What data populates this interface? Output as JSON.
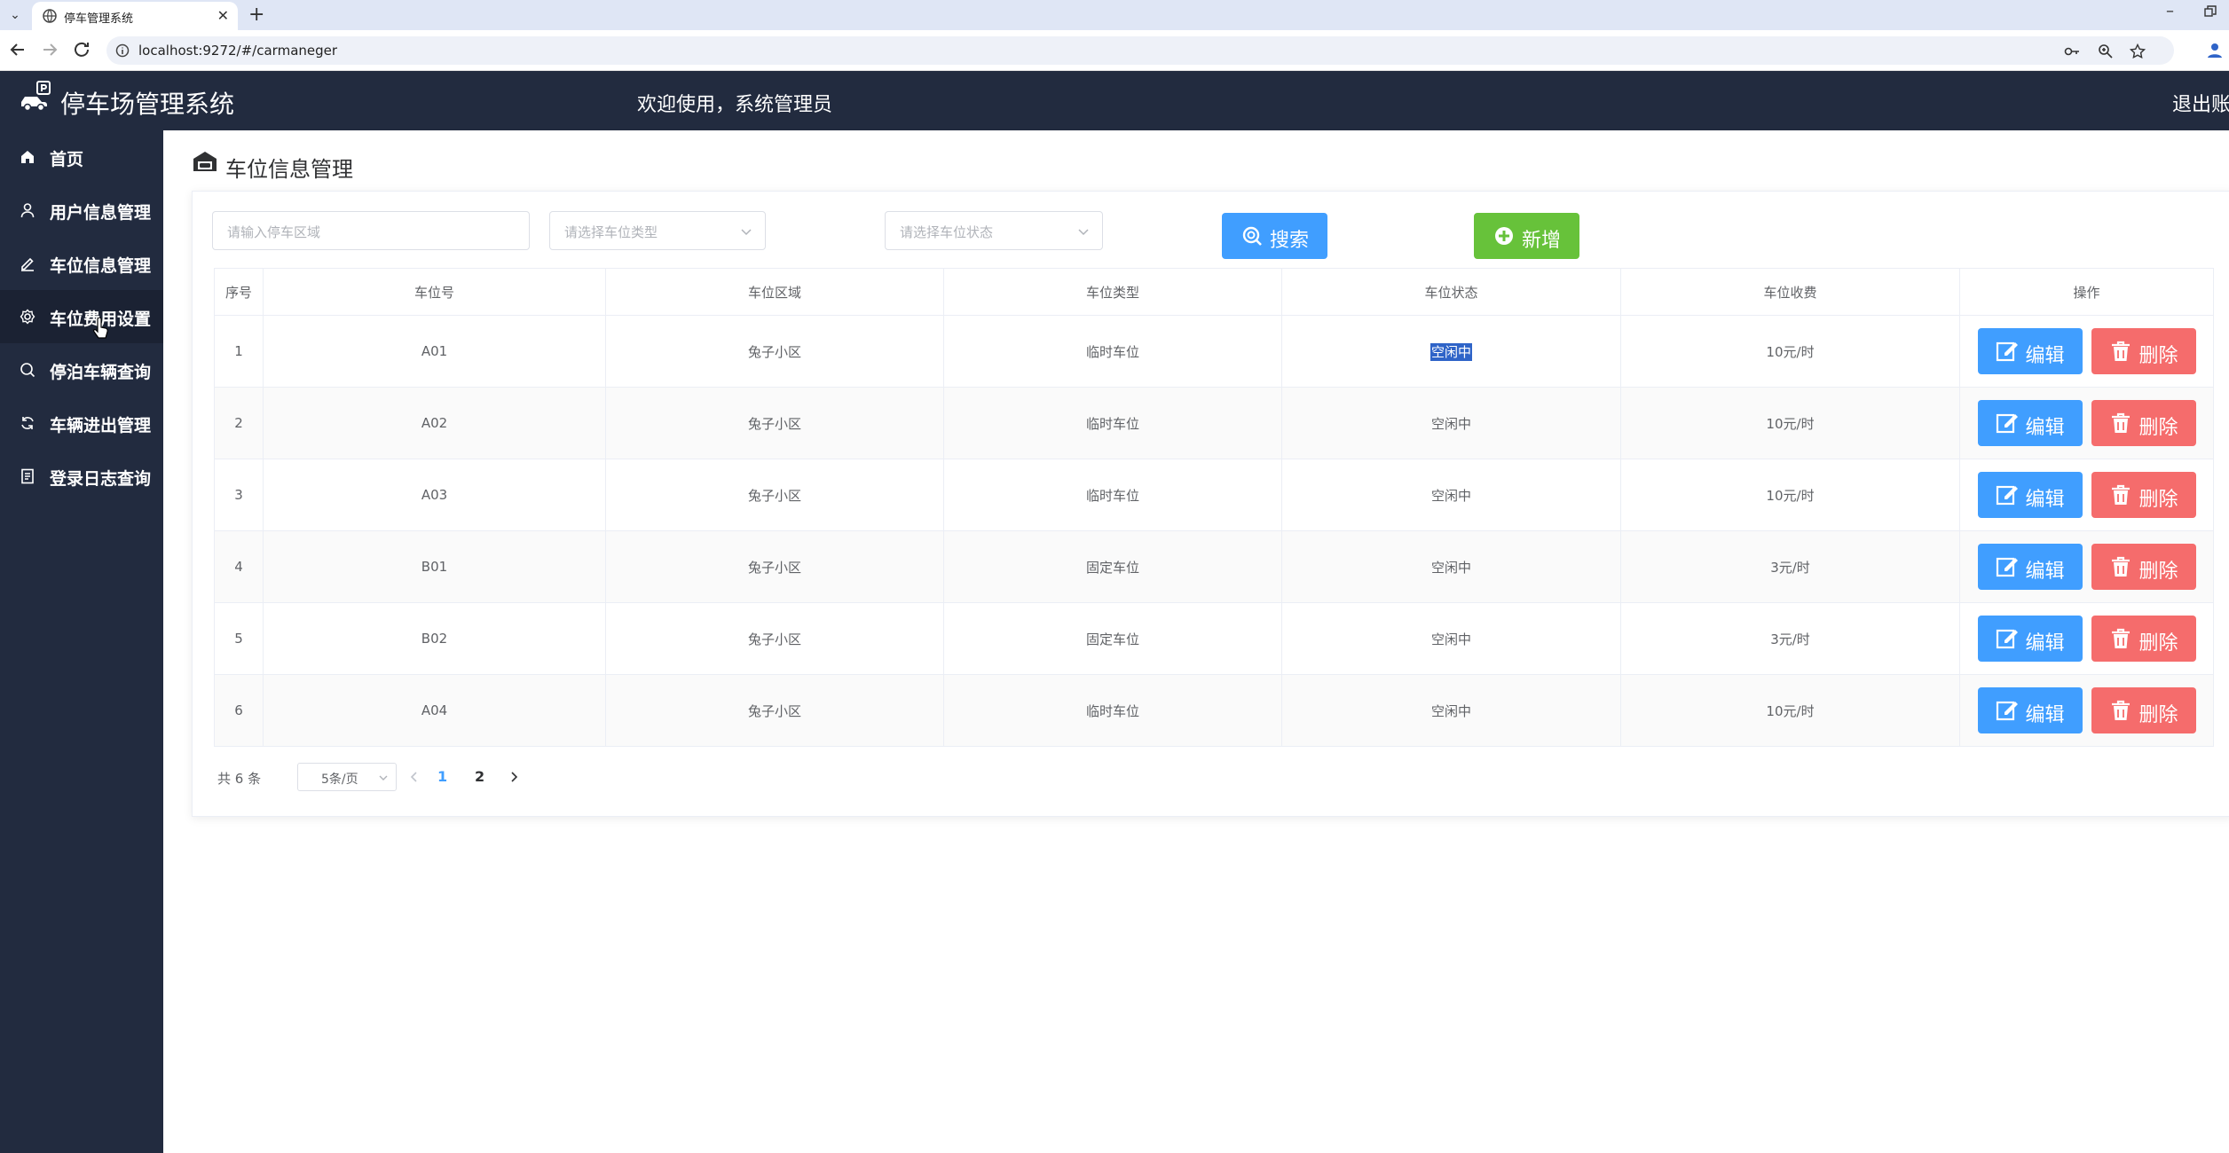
{
  "browser": {
    "tab_title": "停车管理系统",
    "url": "localhost:9272/#/carmaneger"
  },
  "header": {
    "title": "停车场管理系统",
    "welcome": "欢迎使用，系统管理员",
    "logout": "退出账"
  },
  "sidebar": {
    "items": [
      {
        "label": "首页",
        "icon": "home-icon"
      },
      {
        "label": "用户信息管理",
        "icon": "user-icon"
      },
      {
        "label": "车位信息管理",
        "icon": "edit-icon"
      },
      {
        "label": "车位费用设置",
        "icon": "gear-icon"
      },
      {
        "label": "停泊车辆查询",
        "icon": "search-icon"
      },
      {
        "label": "车辆进出管理",
        "icon": "refresh-icon"
      },
      {
        "label": "登录日志查询",
        "icon": "document-icon"
      }
    ],
    "active_index": 3
  },
  "page": {
    "title": "车位信息管理"
  },
  "filters": {
    "area_placeholder": "请输入停车区域",
    "type_placeholder": "请选择车位类型",
    "status_placeholder": "请选择车位状态",
    "search_label": "搜索",
    "add_label": "新增"
  },
  "table": {
    "headers": [
      "序号",
      "车位号",
      "车位区域",
      "车位类型",
      "车位状态",
      "车位收费",
      "操作"
    ],
    "rows": [
      {
        "no": "1",
        "code": "A01",
        "area": "兔子小区",
        "type": "临时车位",
        "status": "空闲中",
        "fee": "10元/时"
      },
      {
        "no": "2",
        "code": "A02",
        "area": "兔子小区",
        "type": "临时车位",
        "status": "空闲中",
        "fee": "10元/时"
      },
      {
        "no": "3",
        "code": "A03",
        "area": "兔子小区",
        "type": "临时车位",
        "status": "空闲中",
        "fee": "10元/时"
      },
      {
        "no": "4",
        "code": "B01",
        "area": "兔子小区",
        "type": "固定车位",
        "status": "空闲中",
        "fee": "3元/时"
      },
      {
        "no": "5",
        "code": "B02",
        "area": "兔子小区",
        "type": "固定车位",
        "status": "空闲中",
        "fee": "3元/时"
      },
      {
        "no": "6",
        "code": "A04",
        "area": "兔子小区",
        "type": "临时车位",
        "status": "空闲中",
        "fee": "10元/时"
      }
    ],
    "edit_label": "编辑",
    "delete_label": "删除"
  },
  "pagination": {
    "total": "共 6 条",
    "page_size": "5条/页",
    "pages": [
      "1",
      "2"
    ],
    "current": "1"
  },
  "colors": {
    "header_bg": "#222b3f",
    "primary": "#409eff",
    "success": "#67c23a",
    "danger": "#f56c6c"
  }
}
